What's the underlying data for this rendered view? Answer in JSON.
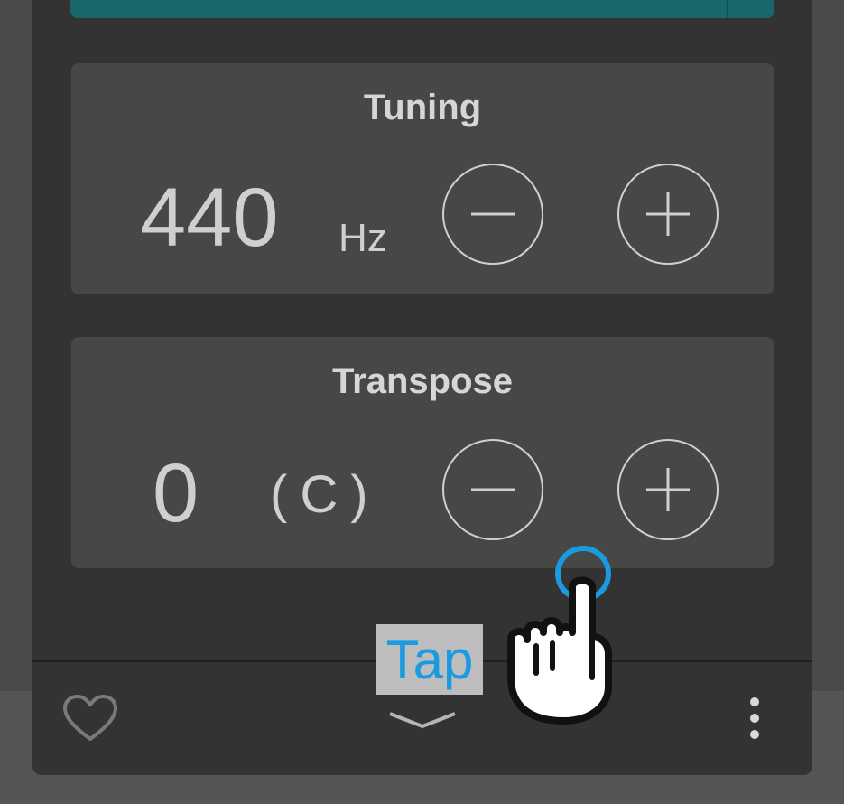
{
  "tuning": {
    "title": "Tuning",
    "value": "440",
    "unit": "Hz"
  },
  "transpose": {
    "title": "Transpose",
    "value": "0",
    "key": "(C)"
  },
  "overlay": {
    "tap_label": "Tap",
    "tap_color": "#1a9be0"
  },
  "footer": {
    "icons": [
      "heart-icon",
      "chevron-down-icon",
      "more-vertical-icon"
    ]
  },
  "colors": {
    "accent_teal": "#17676b",
    "panel": "#333333",
    "card": "#474747"
  }
}
